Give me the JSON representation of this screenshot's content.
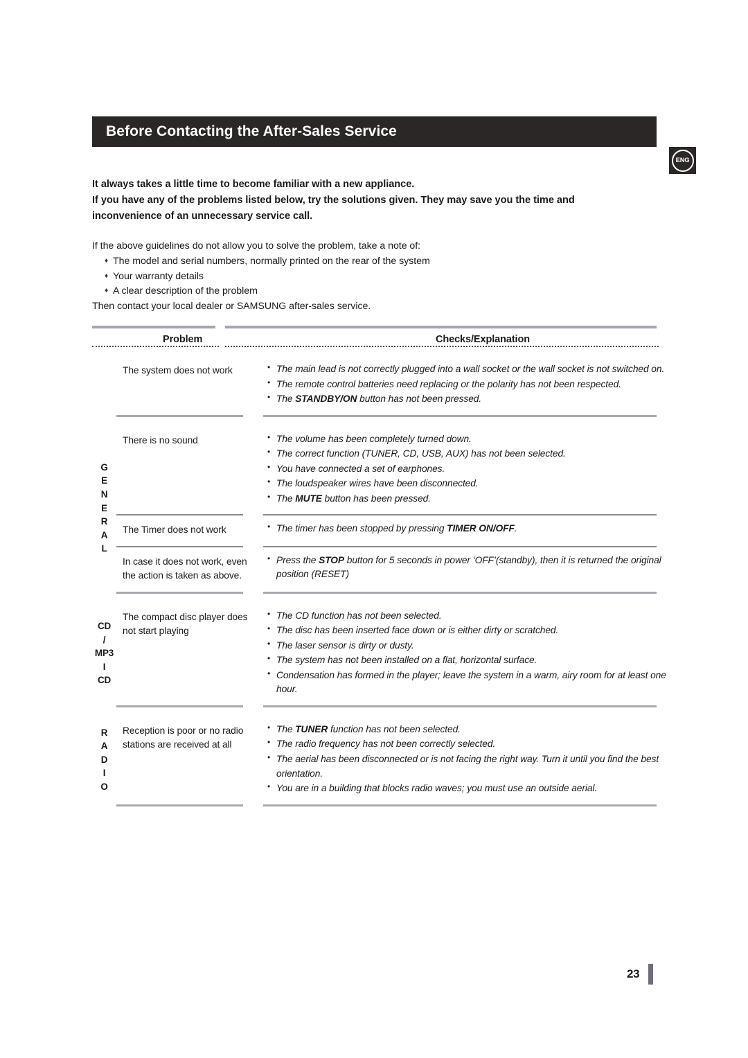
{
  "header": {
    "title": "Before Contacting the After-Sales Service",
    "language_badge": "ENG"
  },
  "intro": {
    "bold_lines": [
      "It always takes a little time to become familiar with a new appliance.",
      "If you have any of the problems listed below, try the solutions given. They may save you the time and",
      "inconvenience of an unnecessary service call."
    ],
    "lead_line": "If the above guidelines do not allow you to solve the problem, take a note of:",
    "bullet_marker": "♦",
    "bullets": [
      "The model and serial numbers, normally printed on the rear of the system",
      "Your warranty details",
      "A clear description of the problem"
    ],
    "closing_line": "Then contact your local dealer or SAMSUNG after-sales service."
  },
  "table": {
    "columns": {
      "problem": "Problem",
      "checks": "Checks/Explanation"
    },
    "sections": [
      {
        "category": "",
        "category_letters": [],
        "rows": [
          {
            "problem": "The system does not work",
            "checks": [
              "The main lead is not correctly plugged into a wall socket or the wall socket is not switched on.",
              "The remote control batteries need replacing or the polarity has not been respected.",
              "The <b>STANDBY/ON</b> button has not been pressed."
            ]
          }
        ]
      },
      {
        "category": "GENERAL",
        "category_letters": [
          "G",
          "E",
          "N",
          "E",
          "R",
          "A",
          "L"
        ],
        "rows": [
          {
            "problem": "There is no sound",
            "checks": [
              "The volume has been completely turned down.",
              "The correct function (TUNER, CD, USB, AUX) has not been selected.",
              "You have connected a set of earphones.",
              "The loudspeaker wires have been disconnected.",
              "The <b>MUTE</b> button has been pressed."
            ]
          },
          {
            "problem": "The Timer does not work",
            "checks": [
              "The timer has been stopped by pressing <b>TIMER ON/OFF</b>."
            ]
          },
          {
            "problem": "In case it does not work, even the action is taken as above.",
            "checks": [
              "Press the <b>STOP</b> button for 5 seconds in power ‘OFF’(standby), then it is returned the original position (RESET)"
            ]
          }
        ]
      },
      {
        "category": "CD / MP3 I CD",
        "category_letters": [
          "CD",
          "/",
          "MP3",
          "I",
          "CD"
        ],
        "rows": [
          {
            "problem": "The compact disc player does not start playing",
            "checks": [
              "The CD function has not been selected.",
              "The disc has been inserted face down or is either dirty or scratched.",
              "The laser sensor is dirty or dusty.",
              "The system has not been installed on a flat, horizontal surface.",
              "Condensation has formed in the player; leave the system in a warm, airy room for at least one hour."
            ]
          }
        ]
      },
      {
        "category": "RADIO",
        "category_letters": [
          "R",
          "A",
          "D",
          "I",
          "O"
        ],
        "rows": [
          {
            "problem": "Reception is poor or no radio stations are received at all",
            "checks": [
              "The <b>TUNER</b> function has not been selected.",
              "The radio frequency has not been correctly selected.",
              "The aerial has been disconnected or is not facing the right way. Turn it until you find the best orientation.",
              "You are in a building that blocks radio waves; you must use an outside aerial."
            ]
          }
        ]
      }
    ]
  },
  "footer": {
    "page_number": "23"
  },
  "colors": {
    "title_bar": "#2b2726",
    "rule_lavender": "#a5a6bb",
    "rule_gray": "#8b8b8b",
    "page_bar": "#6e6e7d"
  }
}
